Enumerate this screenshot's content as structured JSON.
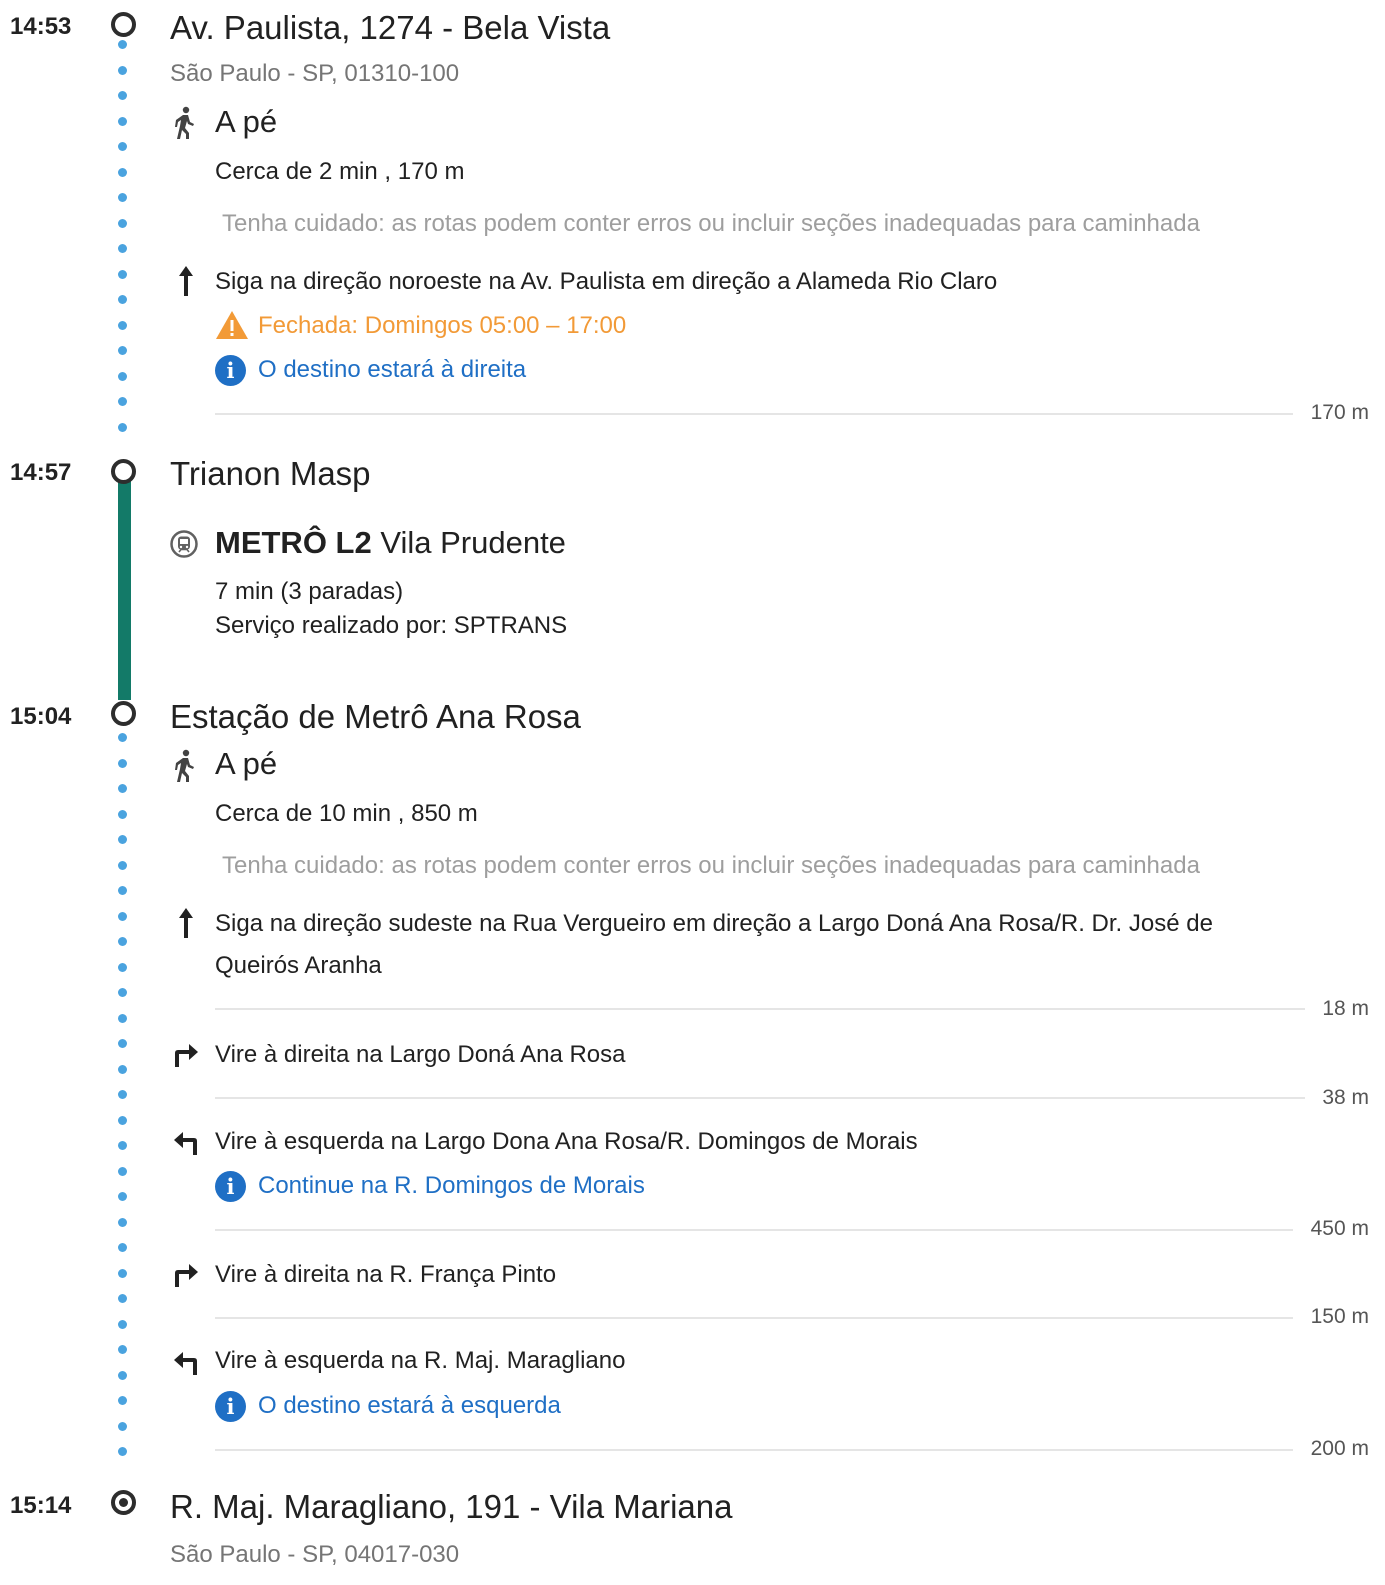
{
  "origin": {
    "time": "14:53",
    "title": "Av. Paulista, 1274 - Bela Vista",
    "address": "São Paulo - SP, 01310-100"
  },
  "walk1": {
    "mode": "A pé",
    "summary": "Cerca de 2 min , 170 m",
    "caution": "Tenha cuidado: as rotas podem conter erros ou incluir seções inadequadas para caminhada",
    "steps": [
      {
        "text": "Siga na direção noroeste na Av. Paulista em direção a Alameda Rio Claro",
        "warning": "Fechada: Domingos 05:00 – 17:00",
        "info": "O destino estará à direita",
        "distance": "170 m"
      }
    ]
  },
  "stop1": {
    "time": "14:57",
    "title": "Trianon Masp"
  },
  "transit": {
    "line": "METRÔ L2",
    "headsign": "Vila Prudente",
    "duration": "7 min (3 paradas)",
    "operator": "Serviço realizado por: SPTRANS",
    "color": "#137a68"
  },
  "stop2": {
    "time": "15:04",
    "title": "Estação de Metrô Ana Rosa"
  },
  "walk2": {
    "mode": "A pé",
    "summary": "Cerca de 10 min , 850 m",
    "caution": "Tenha cuidado: as rotas podem conter erros ou incluir seções inadequadas para caminhada",
    "steps": [
      {
        "icon": "arrow-up-icon",
        "text_line1": "Siga na direção sudeste na Rua Vergueiro em direção a Largo Doná Ana Rosa/R. Dr. José de",
        "text_line2": "Queirós Aranha",
        "distance": "18 m"
      },
      {
        "icon": "turn-right-icon",
        "text": "Vire à direita na Largo Doná Ana Rosa",
        "distance": "38 m"
      },
      {
        "icon": "turn-left-icon",
        "text": "Vire à esquerda na Largo Dona Ana Rosa/R. Domingos de Morais",
        "info": "Continue na R. Domingos de Morais",
        "distance": "450 m"
      },
      {
        "icon": "turn-right-icon",
        "text": "Vire à direita na R. França Pinto",
        "distance": "150 m"
      },
      {
        "icon": "turn-left-icon",
        "text": "Vire à esquerda na R. Maj. Maragliano",
        "info": "O destino estará à esquerda",
        "distance": "200 m"
      }
    ]
  },
  "destination": {
    "time": "15:14",
    "title": "R. Maj. Maragliano, 191 - Vila Mariana",
    "address": "São Paulo - SP, 04017-030"
  }
}
